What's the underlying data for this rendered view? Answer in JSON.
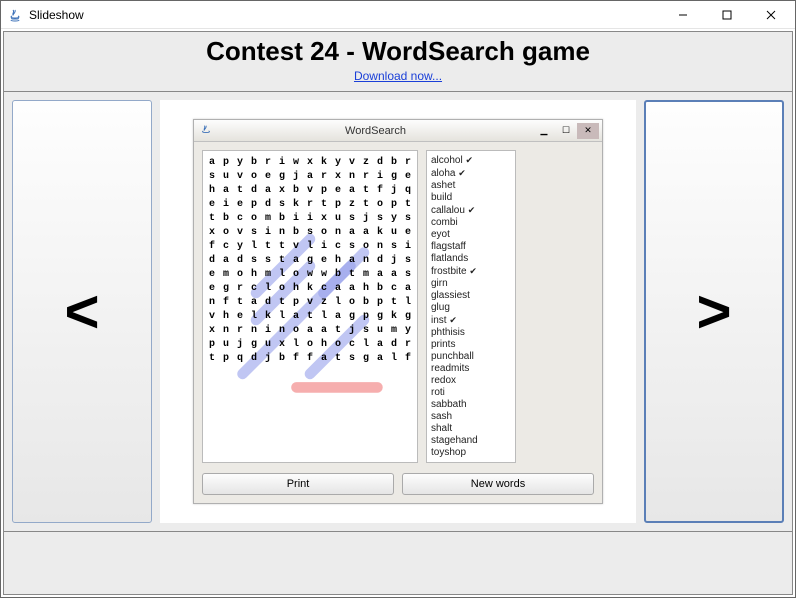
{
  "window": {
    "title": "Slideshow"
  },
  "header": {
    "title": "Contest 24 - WordSearch game",
    "link_label": "Download now..."
  },
  "nav": {
    "prev": "<",
    "next": ">"
  },
  "inner": {
    "title": "WordSearch",
    "print_label": "Print",
    "newwords_label": "New words"
  },
  "grid": [
    [
      "a",
      "p",
      "y",
      "b",
      "r",
      "i",
      "w",
      "x",
      "k",
      "y",
      "v",
      "z",
      "d",
      "b",
      "r"
    ],
    [
      "s",
      "u",
      "v",
      "o",
      "e",
      "g",
      "j",
      "a",
      "r",
      "x",
      "n",
      "r",
      "i",
      "g",
      "e"
    ],
    [
      "h",
      "a",
      "t",
      "d",
      "a",
      "x",
      "b",
      "v",
      "p",
      "e",
      "a",
      "t",
      "f",
      "j",
      "q"
    ],
    [
      "e",
      "i",
      "e",
      "p",
      "d",
      "s",
      "k",
      "r",
      "t",
      "p",
      "z",
      "t",
      "o",
      "p",
      "t"
    ],
    [
      "t",
      "b",
      "c",
      "o",
      "m",
      "b",
      "i",
      "i",
      "x",
      "u",
      "s",
      "j",
      "s",
      "y",
      "s"
    ],
    [
      "x",
      "o",
      "v",
      "s",
      "i",
      "n",
      "b",
      "s",
      "o",
      "n",
      "a",
      "a",
      "k",
      "u",
      "e"
    ],
    [
      "f",
      "c",
      "y",
      "l",
      "t",
      "t",
      "v",
      "l",
      "i",
      "c",
      "s",
      "o",
      "n",
      "s",
      "i"
    ],
    [
      "d",
      "a",
      "d",
      "s",
      "s",
      "t",
      "a",
      "g",
      "e",
      "h",
      "a",
      "n",
      "d",
      "j",
      "s"
    ],
    [
      "e",
      "m",
      "o",
      "h",
      "m",
      "l",
      "o",
      "w",
      "w",
      "b",
      "t",
      "m",
      "a",
      "a",
      "s"
    ],
    [
      "e",
      "g",
      "r",
      "c",
      "l",
      "o",
      "h",
      "k",
      "c",
      "a",
      "a",
      "h",
      "b",
      "c",
      "a"
    ],
    [
      "n",
      "f",
      "t",
      "a",
      "d",
      "t",
      "p",
      "v",
      "z",
      "l",
      "o",
      "b",
      "p",
      "t",
      "l"
    ],
    [
      "v",
      "h",
      "e",
      "l",
      "k",
      "l",
      "a",
      "t",
      "l",
      "a",
      "g",
      "p",
      "g",
      "k",
      "g"
    ],
    [
      "x",
      "n",
      "r",
      "n",
      "i",
      "n",
      "o",
      "a",
      "a",
      "t",
      "j",
      "s",
      "u",
      "m",
      "y"
    ],
    [
      "p",
      "u",
      "j",
      "g",
      "u",
      "x",
      "l",
      "o",
      "h",
      "o",
      "c",
      "l",
      "a",
      "d",
      "r"
    ],
    [
      "t",
      "p",
      "q",
      "d",
      "j",
      "b",
      "f",
      "f",
      "a",
      "t",
      "s",
      "g",
      "a",
      "l",
      "f"
    ]
  ],
  "words": [
    {
      "w": "alcohol",
      "found": true
    },
    {
      "w": "aloha",
      "found": true
    },
    {
      "w": "ashet",
      "found": false
    },
    {
      "w": "build",
      "found": false
    },
    {
      "w": "callalou",
      "found": true
    },
    {
      "w": "combi",
      "found": false
    },
    {
      "w": "eyot",
      "found": false
    },
    {
      "w": "flagstaff",
      "found": false
    },
    {
      "w": "flatlands",
      "found": false
    },
    {
      "w": "frostbite",
      "found": true
    },
    {
      "w": "girn",
      "found": false
    },
    {
      "w": "glassiest",
      "found": false
    },
    {
      "w": "glug",
      "found": false
    },
    {
      "w": "inst",
      "found": true
    },
    {
      "w": "phthisis",
      "found": false
    },
    {
      "w": "prints",
      "found": false
    },
    {
      "w": "punchball",
      "found": false
    },
    {
      "w": "readmits",
      "found": false
    },
    {
      "w": "redox",
      "found": false
    },
    {
      "w": "roti",
      "found": false
    },
    {
      "w": "sabbath",
      "found": false
    },
    {
      "w": "sash",
      "found": false
    },
    {
      "w": "shalt",
      "found": false
    },
    {
      "w": "stagehand",
      "found": false
    },
    {
      "w": "toyshop",
      "found": false
    }
  ],
  "highlights": [
    {
      "r1": 2,
      "c1": 7,
      "r2": 6,
      "c2": 3,
      "type": "found"
    },
    {
      "r1": 4,
      "c1": 7,
      "r2": 8,
      "c2": 3,
      "type": "found"
    },
    {
      "r1": 3,
      "c1": 11,
      "r2": 6,
      "c2": 8,
      "type": "found"
    },
    {
      "r1": 4,
      "c1": 10,
      "r2": 12,
      "c2": 2,
      "type": "found"
    },
    {
      "r1": 8,
      "c1": 11,
      "r2": 12,
      "c2": 7,
      "type": "found"
    },
    {
      "r1": 13,
      "c1": 6,
      "r2": 13,
      "c2": 12,
      "type": "current"
    }
  ]
}
